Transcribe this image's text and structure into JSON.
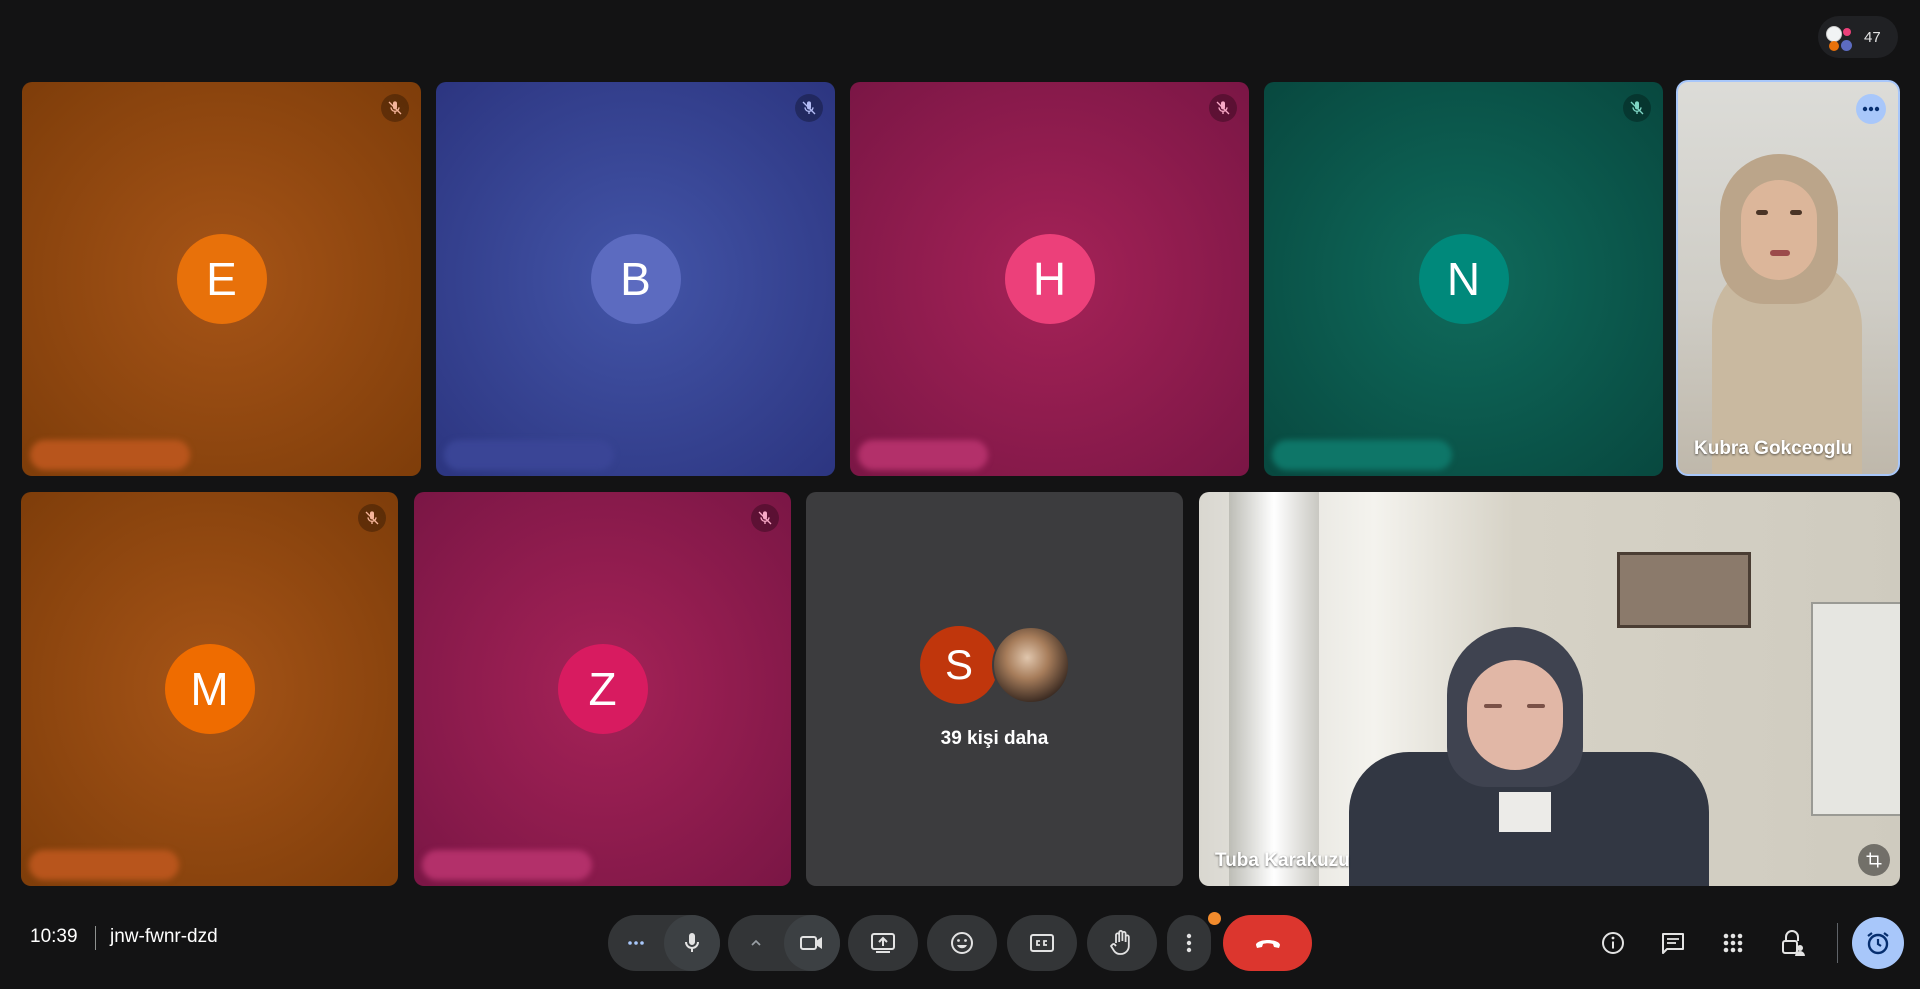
{
  "top_right": {
    "participant_count": "47"
  },
  "tiles": {
    "e": {
      "initial": "E",
      "color": "#e8710a"
    },
    "b": {
      "initial": "B",
      "color": "#5c6bc0"
    },
    "h": {
      "initial": "H",
      "color": "#ec407a"
    },
    "n": {
      "initial": "N",
      "color": "#00897b"
    },
    "kubra": {
      "name": "Kubra Gokceoglu"
    },
    "m": {
      "initial": "M",
      "color": "#ef6c00"
    },
    "z": {
      "initial": "Z",
      "color": "#d81b60"
    },
    "more": {
      "initial": "S",
      "label": "39 kişi daha"
    },
    "tuba": {
      "name": "Tuba Karakuzu"
    }
  },
  "bottom_bar": {
    "time": "10:39",
    "meeting_code": "jnw-fwnr-dzd"
  },
  "colors": {
    "background": "#131314",
    "hangup": "#dc362e",
    "control_bg": "#333537",
    "accent": "#a8c7fa"
  }
}
